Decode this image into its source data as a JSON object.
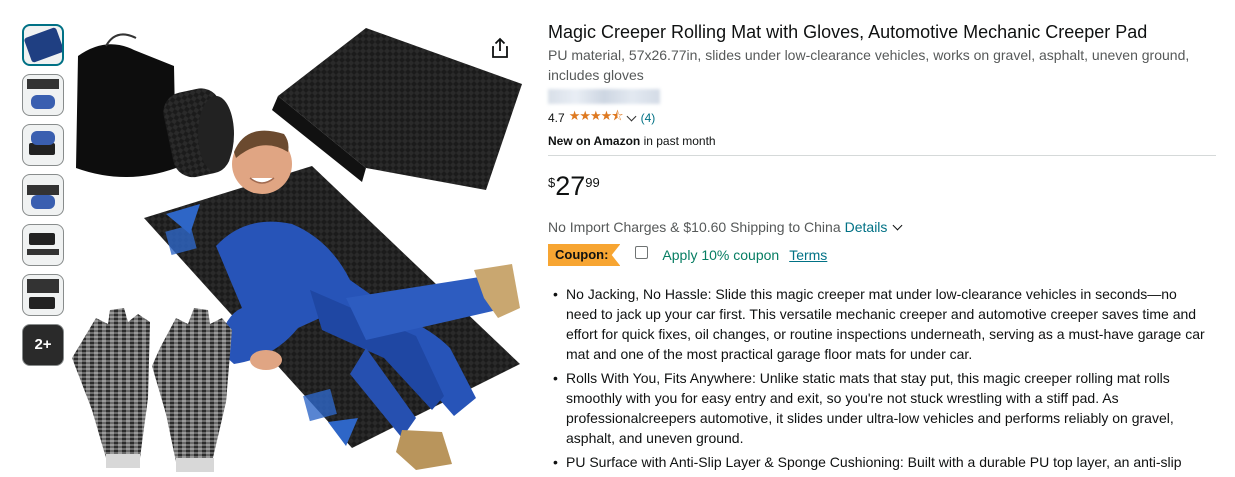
{
  "product": {
    "title": "Magic Creeper Rolling Mat with Gloves, Automotive Mechanic Creeper Pad",
    "subtitle": "PU material, 57x26.77in, slides under low-clearance vehicles, works on gravel, asphalt, uneven ground, includes gloves",
    "rating": "4.7",
    "stars_icon": "★★★★⯪",
    "review_count": "(4)",
    "new_label": "New on Amazon",
    "new_suffix": " in past month",
    "price": {
      "symbol": "$",
      "whole": "27",
      "fraction": "99"
    },
    "shipping_text": "No Import Charges & $10.60 Shipping to China",
    "details_link": "Details",
    "coupon": {
      "badge": "Coupon:",
      "text": "Apply 10% coupon",
      "terms": "Terms"
    },
    "bullets": [
      "No Jacking, No Hassle: Slide this magic creeper mat under low-clearance vehicles in seconds—no need to jack up your car first. This versatile mechanic creeper and automotive creeper saves time and effort for quick fixes, oil changes, or routine inspections underneath, serving as a must-have garage car mat and one of the most practical garage floor mats for under car.",
      "Rolls With You, Fits Anywhere: Unlike static mats that stay put, this magic creeper rolling mat rolls smoothly with you for easy entry and exit, so you're not stuck wrestling with a stiff pad. As professionalcreepers automotive, it slides under ultra-low vehicles and performs reliably on gravel, asphalt, and uneven ground.",
      "PU Surface with Anti-Slip Layer & Sponge Cushioning: Built with a durable PU top layer, an anti-slip layer underneath to keep the mat steady on hard surfaces, and a sponge core for cushioning. This"
    ]
  },
  "gallery": {
    "more_label": "2+"
  },
  "icons": {
    "share": "share-icon",
    "chevron": "chevron-down-icon"
  },
  "colors": {
    "link": "#007185",
    "coupon_badge": "#f7a532",
    "coupon_text": "#067d62",
    "star": "#de7921"
  }
}
